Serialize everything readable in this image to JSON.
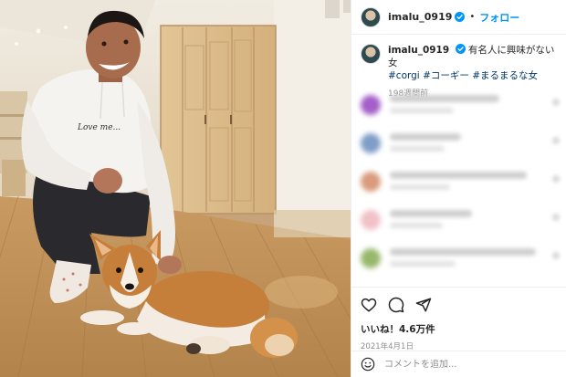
{
  "post": {
    "username": "imalu_0919",
    "separator": "•",
    "follow_label": "フォロー",
    "caption_text": "有名人に興味がない女",
    "hashtags": [
      "#corgi",
      "#コーギー",
      "#まるまるな女"
    ],
    "caption_age": "198週間前",
    "likes": "いいね！4.6万件",
    "date": "2021年4月1日",
    "comment_placeholder": "コメントを追加..."
  },
  "photo": {
    "person_shirt_text": "Love me..."
  },
  "icons": {
    "verified": "verified-badge-icon",
    "like": "heart-icon",
    "comment": "comment-icon",
    "share": "share-icon",
    "emoji": "emoji-icon"
  },
  "colors": {
    "link_blue": "#0095f6",
    "hashtag": "#00376b",
    "muted": "#8e8e8e",
    "text": "#262626",
    "border": "#efefef"
  }
}
